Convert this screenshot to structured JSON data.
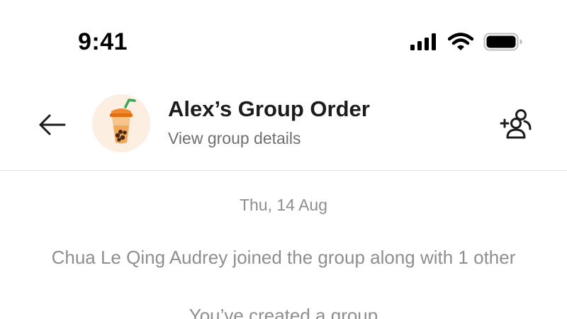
{
  "status_bar": {
    "time": "9:41",
    "icons": [
      "cellular-signal-icon",
      "wifi-icon",
      "battery-icon"
    ]
  },
  "header": {
    "back_icon": "arrow-left-icon",
    "avatar_icon": "bubble-tea-icon",
    "title": "Alex’s Group Order",
    "subtitle": "View group details",
    "action_icon": "add-people-icon"
  },
  "conversation": {
    "date": "Thu, 14 Aug",
    "system_messages": [
      "Chua Le Qing Audrey joined the group along with 1 other",
      "You’ve created a group"
    ]
  },
  "colors": {
    "background": "#ffffff",
    "primary_text": "#1c1c1e",
    "secondary_text": "#8e8e8e",
    "avatar_background": "#fdeee2",
    "divider": "#e3e3e3"
  }
}
